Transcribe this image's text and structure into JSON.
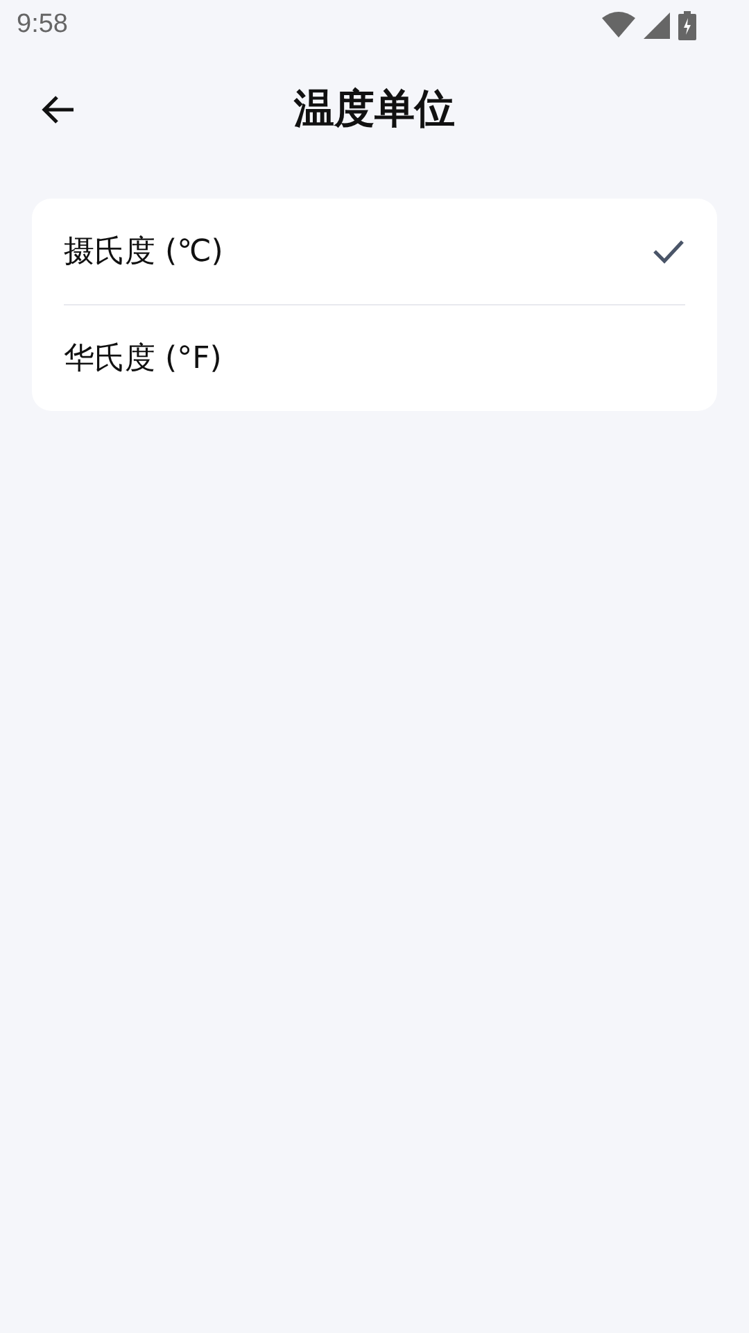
{
  "status_bar": {
    "time": "9:58"
  },
  "header": {
    "title": "温度单位"
  },
  "options": [
    {
      "label": "摄氏度 (℃)",
      "selected": true
    },
    {
      "label": "华氏度 (°F)",
      "selected": false
    }
  ]
}
